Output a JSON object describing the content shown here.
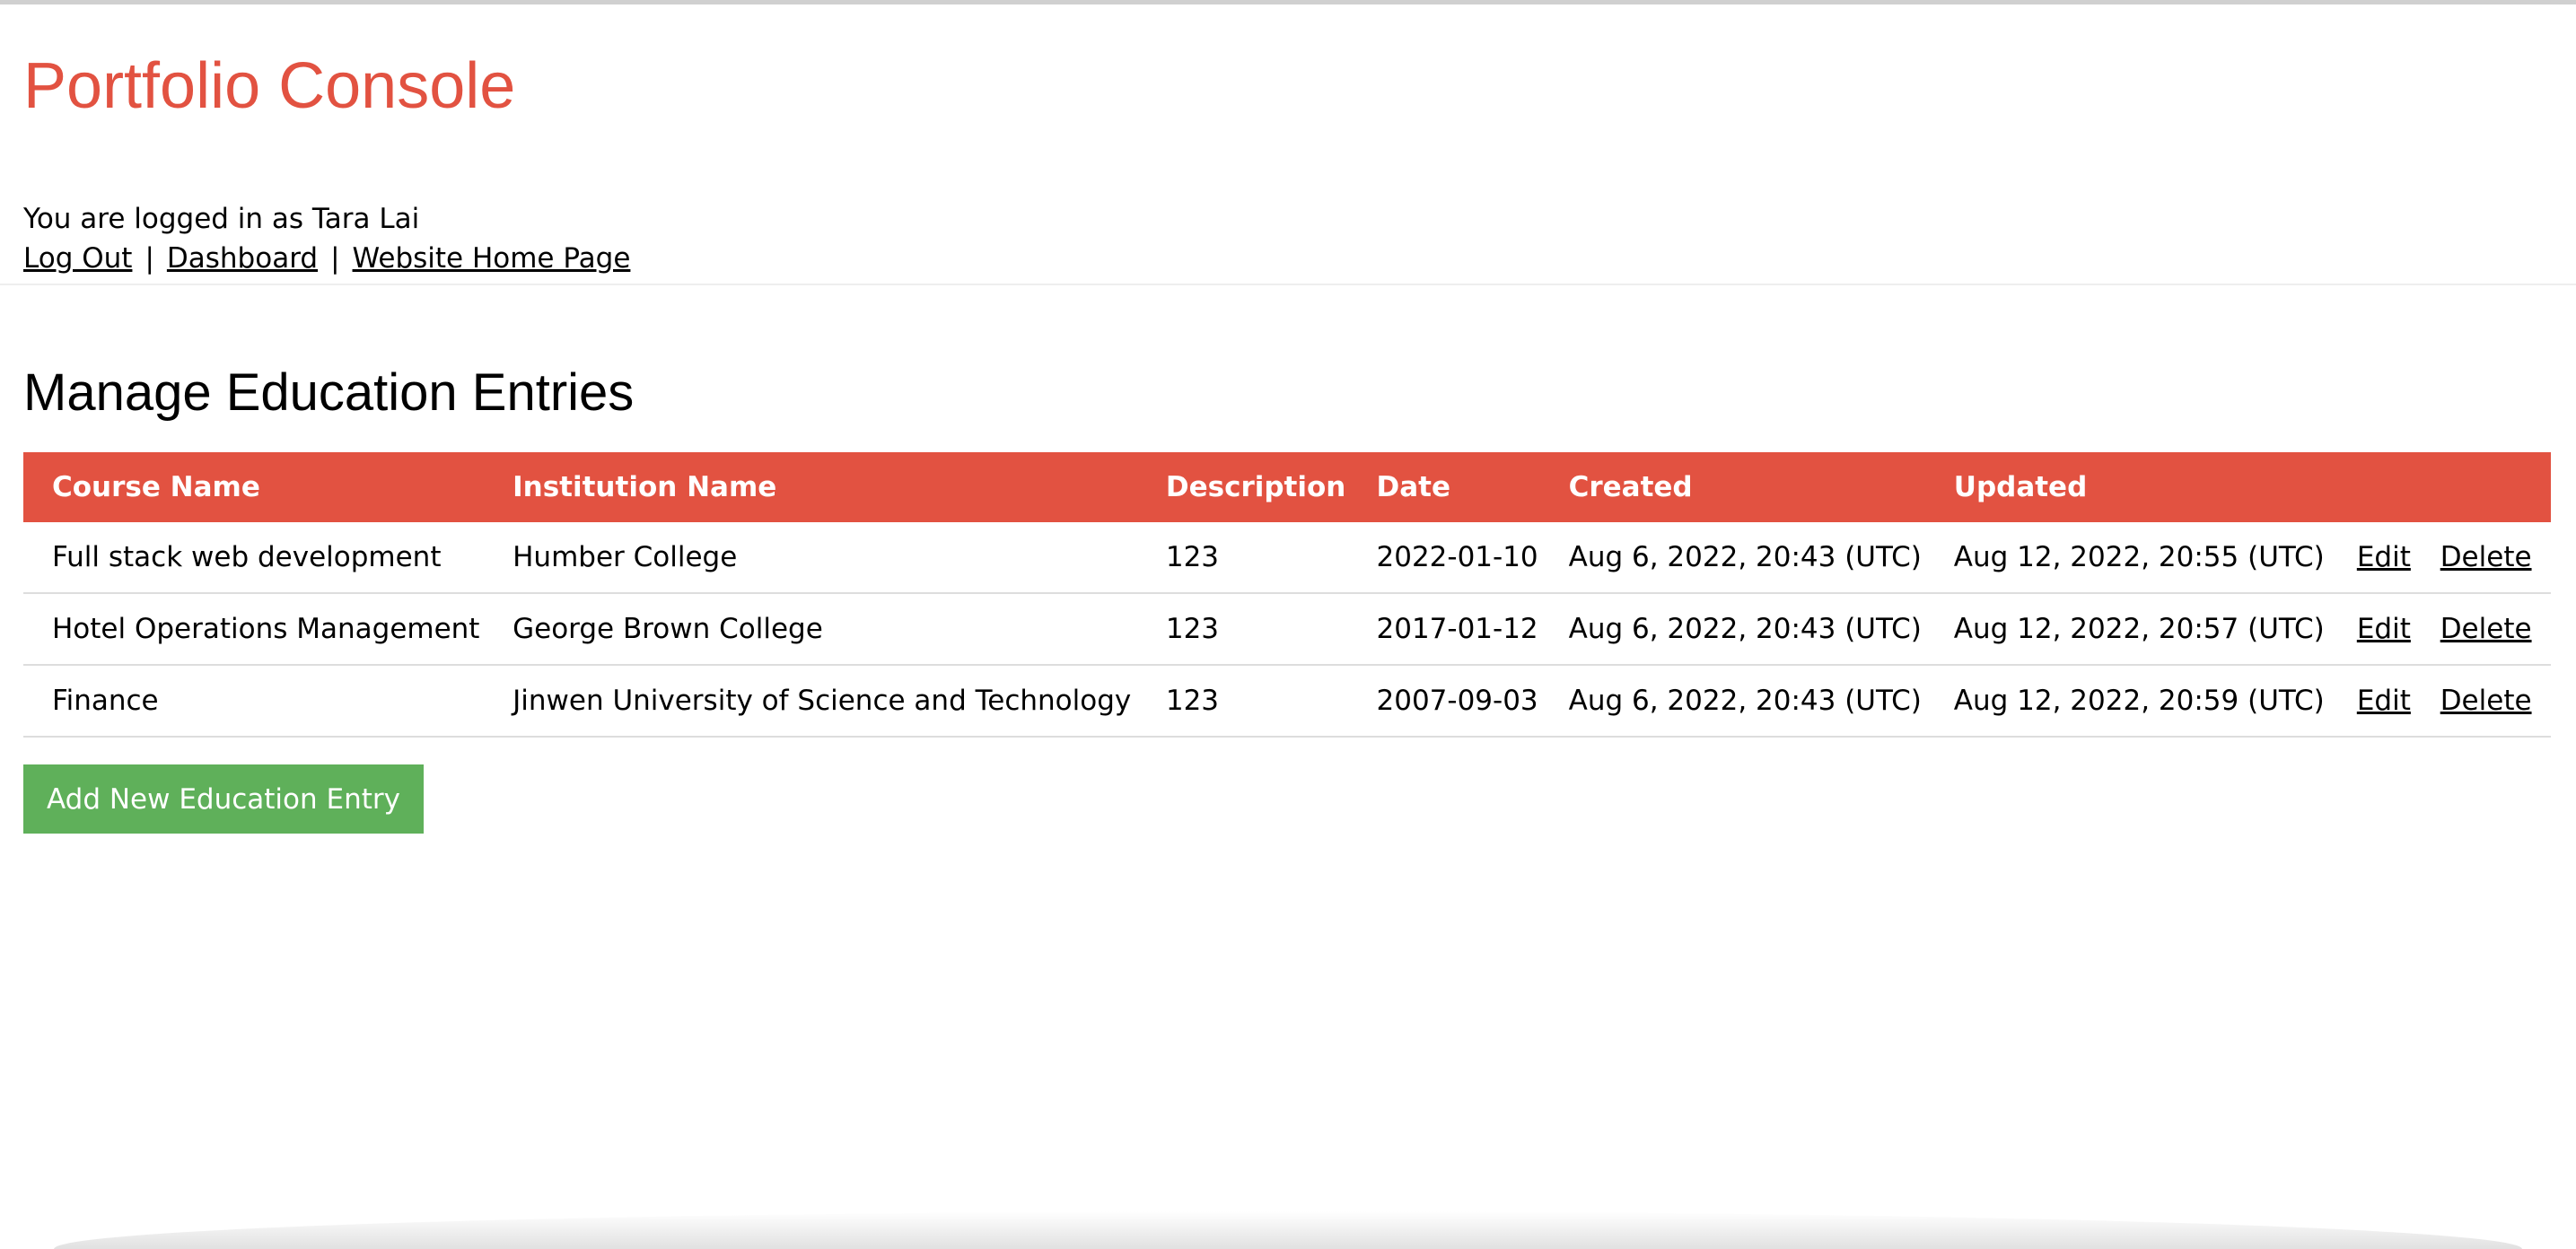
{
  "header": {
    "app_title": "Portfolio Console",
    "login_text": "You are logged in as Tara Lai",
    "nav": {
      "log_out": "Log Out",
      "dashboard": "Dashboard",
      "home": "Website Home Page",
      "separator": "|"
    }
  },
  "main": {
    "section_title": "Manage Education Entries",
    "columns": [
      "Course Name",
      "Institution Name",
      "Description",
      "Date",
      "Created",
      "Updated"
    ],
    "rows": [
      {
        "course": "Full stack web development",
        "institution": "Humber College",
        "description": "123",
        "date": "2022-01-10",
        "created": "Aug 6, 2022, 20:43 (UTC)",
        "updated": "Aug 12, 2022, 20:55 (UTC)",
        "edit": "Edit",
        "delete": "Delete"
      },
      {
        "course": "Hotel Operations Management",
        "institution": "George Brown College",
        "description": "123",
        "date": "2017-01-12",
        "created": "Aug 6, 2022, 20:43 (UTC)",
        "updated": "Aug 12, 2022, 20:57 (UTC)",
        "edit": "Edit",
        "delete": "Delete"
      },
      {
        "course": "Finance",
        "institution": "Jinwen University of Science and Technology",
        "description": "123",
        "date": "2007-09-03",
        "created": "Aug 6, 2022, 20:43 (UTC)",
        "updated": "Aug 12, 2022, 20:59 (UTC)",
        "edit": "Edit",
        "delete": "Delete"
      }
    ],
    "add_button_label": "Add New Education Entry"
  },
  "colors": {
    "accent": "#e25241",
    "button": "#5fb05a",
    "row_border": "#dddddd"
  }
}
